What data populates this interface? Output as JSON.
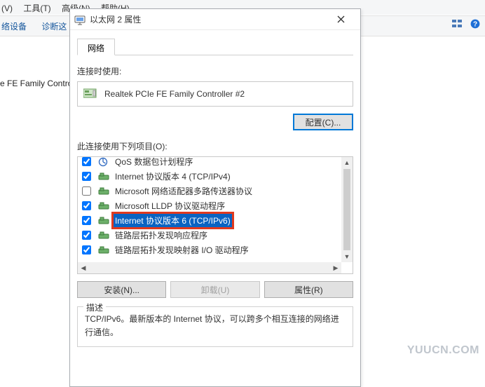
{
  "bg": {
    "menu": {
      "m1": "(V)",
      "m2": "工具(T)",
      "m3": "高级(N)",
      "m4": "帮助(H)"
    },
    "toolbar": {
      "t1": "络设备",
      "t2": "诊断这"
    },
    "item_text": "e FE Family Controll"
  },
  "dialog": {
    "title": "以太网 2 属性",
    "tab_label": "网络",
    "connect_using_label": "连接时使用:",
    "adapter_name": "Realtek PCIe FE Family Controller #2",
    "configure_btn": "配置(C)...",
    "items_label": "此连接使用下列项目(O):",
    "items": [
      {
        "checked": true,
        "icon": "qos",
        "label": "QoS 数据包计划程序"
      },
      {
        "checked": true,
        "icon": "proto",
        "label": "Internet 协议版本 4 (TCP/IPv4)"
      },
      {
        "checked": false,
        "icon": "proto",
        "label": "Microsoft 网络适配器多路传送器协议"
      },
      {
        "checked": true,
        "icon": "proto",
        "label": "Microsoft LLDP 协议驱动程序"
      },
      {
        "checked": true,
        "icon": "proto",
        "label": "Internet 协议版本 6 (TCP/IPv6)",
        "selected": true
      },
      {
        "checked": true,
        "icon": "proto",
        "label": "链路层拓扑发现响应程序"
      },
      {
        "checked": true,
        "icon": "proto",
        "label": "链路层拓扑发现映射器 I/O 驱动程序"
      }
    ],
    "install_btn": "安装(N)...",
    "uninstall_btn": "卸载(U)",
    "properties_btn": "属性(R)",
    "desc_legend": "描述",
    "desc_text": "TCP/IPv6。最新版本的 Internet 协议，可以跨多个相互连接的网络进行通信。"
  },
  "watermark": "YUUCN.COM"
}
